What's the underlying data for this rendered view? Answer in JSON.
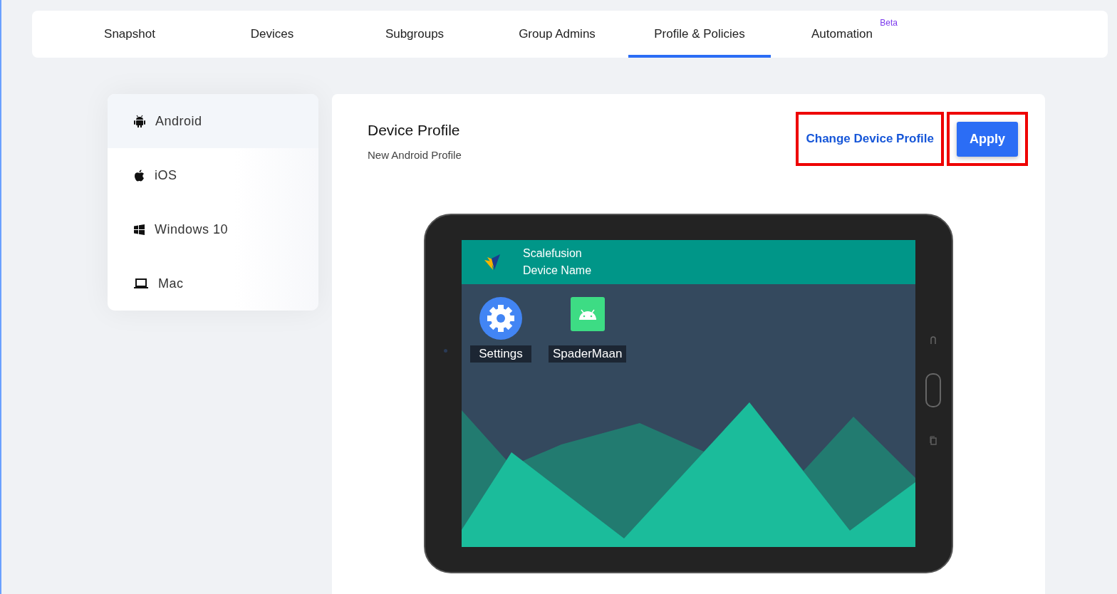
{
  "tabs": [
    {
      "label": "Snapshot",
      "selected": false
    },
    {
      "label": "Devices",
      "selected": false
    },
    {
      "label": "Subgroups",
      "selected": false
    },
    {
      "label": "Group Admins",
      "selected": false
    },
    {
      "label": "Profile & Policies",
      "selected": true
    },
    {
      "label": "Automation",
      "selected": false,
      "badge": "Beta"
    }
  ],
  "sidebar": {
    "items": [
      {
        "label": "Android",
        "kind": "android",
        "selected": true
      },
      {
        "label": "iOS",
        "kind": "apple",
        "selected": false
      },
      {
        "label": "Windows 10",
        "kind": "windows",
        "selected": false
      },
      {
        "label": "Mac",
        "kind": "laptop",
        "selected": false
      }
    ]
  },
  "profile": {
    "title": "Device Profile",
    "subtitle": "New Android Profile",
    "actions": [
      {
        "label": "Change Device Profile",
        "kind": "link",
        "highlighted": true
      },
      {
        "label": "Apply",
        "kind": "primary",
        "highlighted": true
      }
    ]
  },
  "device_preview": {
    "header_title": "Scalefusion",
    "header_subtitle": "Device Name",
    "apps": [
      {
        "label": "Settings",
        "kind": "settings"
      },
      {
        "label": "SpaderMaan",
        "kind": "android"
      }
    ]
  }
}
